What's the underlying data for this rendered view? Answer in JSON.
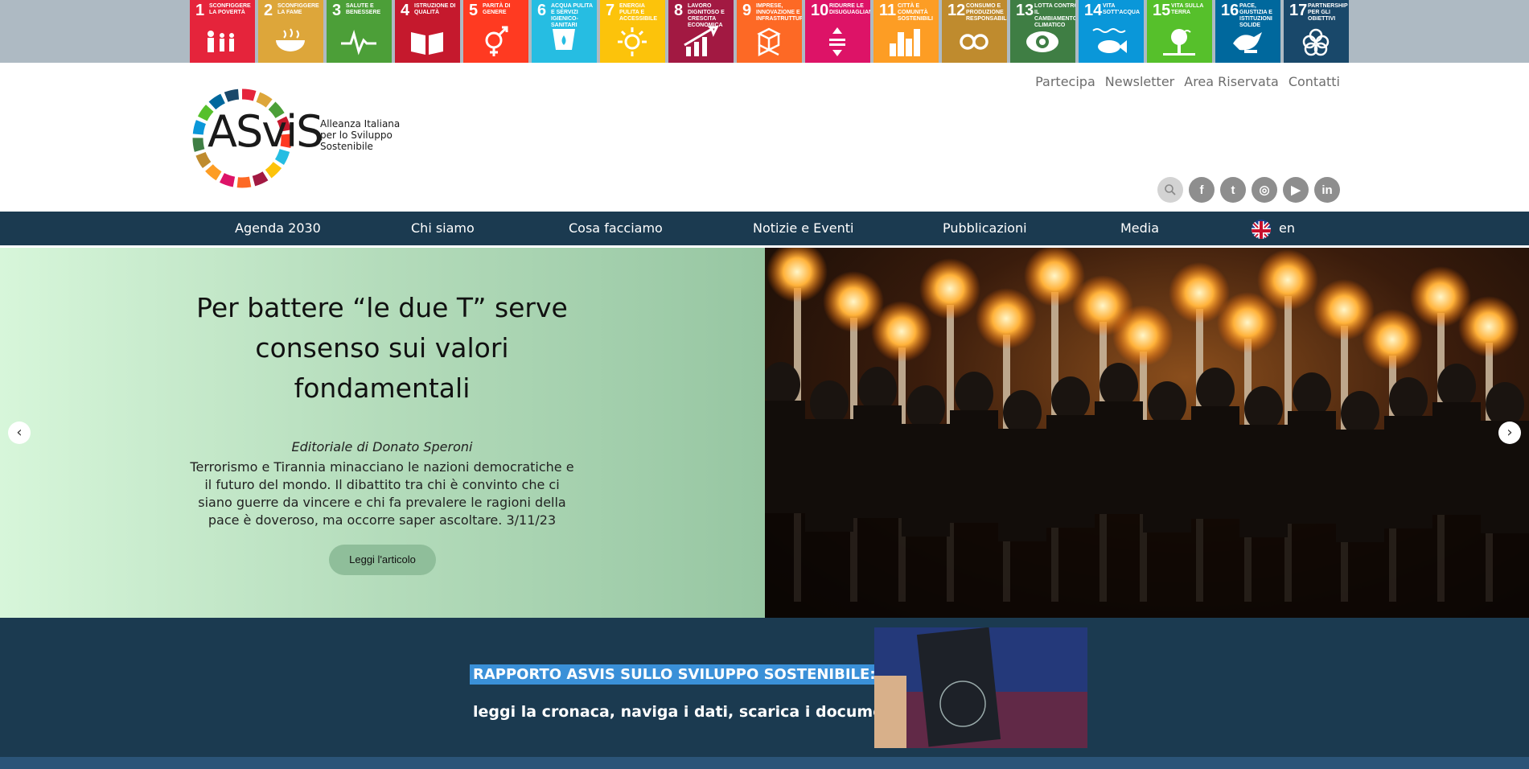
{
  "sdg": [
    {
      "num": "1",
      "text": "SCONFIGGERE LA POVERTÀ",
      "color": "#e5243b"
    },
    {
      "num": "2",
      "text": "SCONFIGGERE LA FAME",
      "color": "#dda63a"
    },
    {
      "num": "3",
      "text": "SALUTE E BENESSERE",
      "color": "#4c9f38"
    },
    {
      "num": "4",
      "text": "ISTRUZIONE DI QUALITÀ",
      "color": "#c5192d"
    },
    {
      "num": "5",
      "text": "PARITÀ DI GENERE",
      "color": "#ff3a21"
    },
    {
      "num": "6",
      "text": "ACQUA PULITA E SERVIZI IGIENICO-SANITARI",
      "color": "#26bde2"
    },
    {
      "num": "7",
      "text": "ENERGIA PULITA E ACCESSIBILE",
      "color": "#fcc30b"
    },
    {
      "num": "8",
      "text": "LAVORO DIGNITOSO E CRESCITA ECONOMICA",
      "color": "#a21942"
    },
    {
      "num": "9",
      "text": "IMPRESE, INNOVAZIONE E INFRASTRUTTURE",
      "color": "#fd6925"
    },
    {
      "num": "10",
      "text": "RIDURRE LE DISUGUAGLIANZE",
      "color": "#dd1367"
    },
    {
      "num": "11",
      "text": "CITTÀ E COMUNITÀ SOSTENIBILI",
      "color": "#fd9d24"
    },
    {
      "num": "12",
      "text": "CONSUMO E PRODUZIONE RESPONSABILI",
      "color": "#bf8b2e"
    },
    {
      "num": "13",
      "text": "LOTTA CONTRO IL CAMBIAMENTO CLIMATICO",
      "color": "#3f7e44"
    },
    {
      "num": "14",
      "text": "VITA SOTT'ACQUA",
      "color": "#0a97d9"
    },
    {
      "num": "15",
      "text": "VITA SULLA TERRA",
      "color": "#56c02b"
    },
    {
      "num": "16",
      "text": "PACE, GIUSTIZIA E ISTITUZIONI SOLIDE",
      "color": "#00689d"
    },
    {
      "num": "17",
      "text": "PARTNERSHIP PER GLI OBIETTIVI",
      "color": "#19486a"
    }
  ],
  "util_links": [
    "Partecipa",
    "Newsletter",
    "Area Riservata",
    "Contatti"
  ],
  "logo": {
    "text": "ASviS",
    "sub1": "Alleanza Italiana",
    "sub2": "per lo Sviluppo",
    "sub3": "Sostenibile"
  },
  "social": {
    "search": "search-icon",
    "facebook": "f",
    "twitter": "t",
    "instagram": "◎",
    "youtube": "▶",
    "linkedin": "in"
  },
  "nav": {
    "agenda": "Agenda 2030",
    "chi": "Chi siamo",
    "cosa": "Cosa facciamo",
    "notizie": "Notizie e Eventi",
    "pubblicazioni": "Pubblicazioni",
    "media": "Media",
    "lang": "en"
  },
  "hero": {
    "title": "Per battere “le due T” serve consenso sui valori fondamentali",
    "byline": "Editoriale di Donato Speroni",
    "desc": "Terrorismo e Tirannia minacciano le nazioni democratiche e il futuro del mondo. Il dibattito tra chi è convinto che ci siano guerre da vincere e chi fa prevalere le ragioni della pace è doveroso, ma occorre saper ascoltare. 3/11/23",
    "button": "Leggi l'articolo"
  },
  "report": {
    "title": "RAPPORTO ASVIS SULLO SVILUPPO SOSTENIBILE:",
    "subtitle": "leggi la cronaca, naviga i dati, scarica i documenti"
  }
}
